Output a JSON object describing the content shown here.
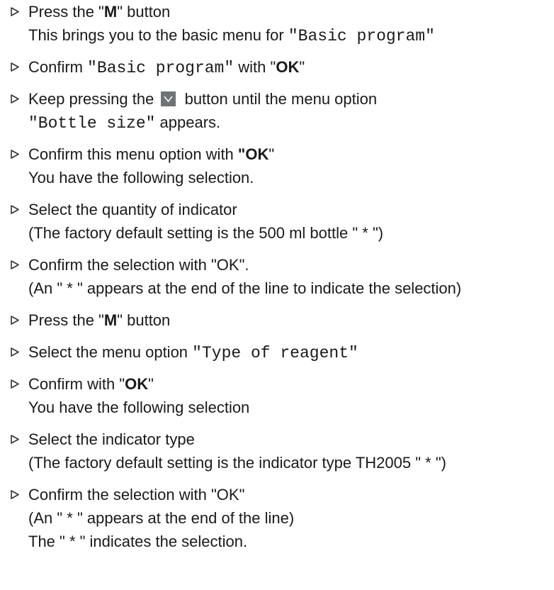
{
  "steps": [
    {
      "line1": {
        "a": "Press the \"",
        "b": "M",
        "c": "\" button"
      },
      "line2": {
        "a": "This brings you to the basic menu for ",
        "mono": "\"Basic program\""
      }
    },
    {
      "line1": {
        "a": "Confirm ",
        "mono": "\"Basic program\"",
        "b": " with \"",
        "bold": "OK",
        "c": "\""
      }
    },
    {
      "line1": {
        "a": "Keep pressing the ",
        "b": " button until the menu option"
      },
      "line2": {
        "mono": "\"Bottle size\"",
        "a": " appears."
      },
      "icon": "chevron-down-button"
    },
    {
      "line1": {
        "a": "Confirm this menu option with ",
        "bold": "\"OK",
        "c": "\""
      },
      "line2": {
        "a": "You have the following selection."
      }
    },
    {
      "line1": {
        "a": "Select the quantity of indicator"
      },
      "line2": {
        "a": "(The factory default setting is the 500 ml bottle \" * \")"
      }
    },
    {
      "line1": {
        "a": "Confirm the selection with \"OK\"."
      },
      "line2": {
        "a": "(An \" * \" appears at the end of the line to indicate the selection)"
      }
    },
    {
      "line1": {
        "a": "Press the \"",
        "b": "M",
        "c": "\" button"
      }
    },
    {
      "line1": {
        "a": "Select the menu option ",
        "mono": "\"Type of reagent\""
      }
    },
    {
      "line1": {
        "a": "Confirm with \"",
        "b": "OK",
        "c": "\""
      },
      "line2": {
        "a": "You have the following selection"
      }
    },
    {
      "line1": {
        "a": "Select the indicator type"
      },
      "line2": {
        "a": "(The factory default setting is the indicator type TH2005 \" * \")"
      }
    },
    {
      "line1": {
        "a": "Confirm the selection with \"OK\""
      },
      "line2": {
        "a": "(An \" * \" appears at the end of the line)"
      },
      "line3": {
        "a": "The \" * \" indicates the selection."
      }
    }
  ],
  "colors": {
    "text": "#1a1a1a",
    "arrow": "#333333",
    "button_bg": "#6f7377",
    "button_glyph": "#ffffff"
  },
  "icons": {
    "bullet": "triangle-right-icon",
    "button": "chevron-down-icon"
  }
}
